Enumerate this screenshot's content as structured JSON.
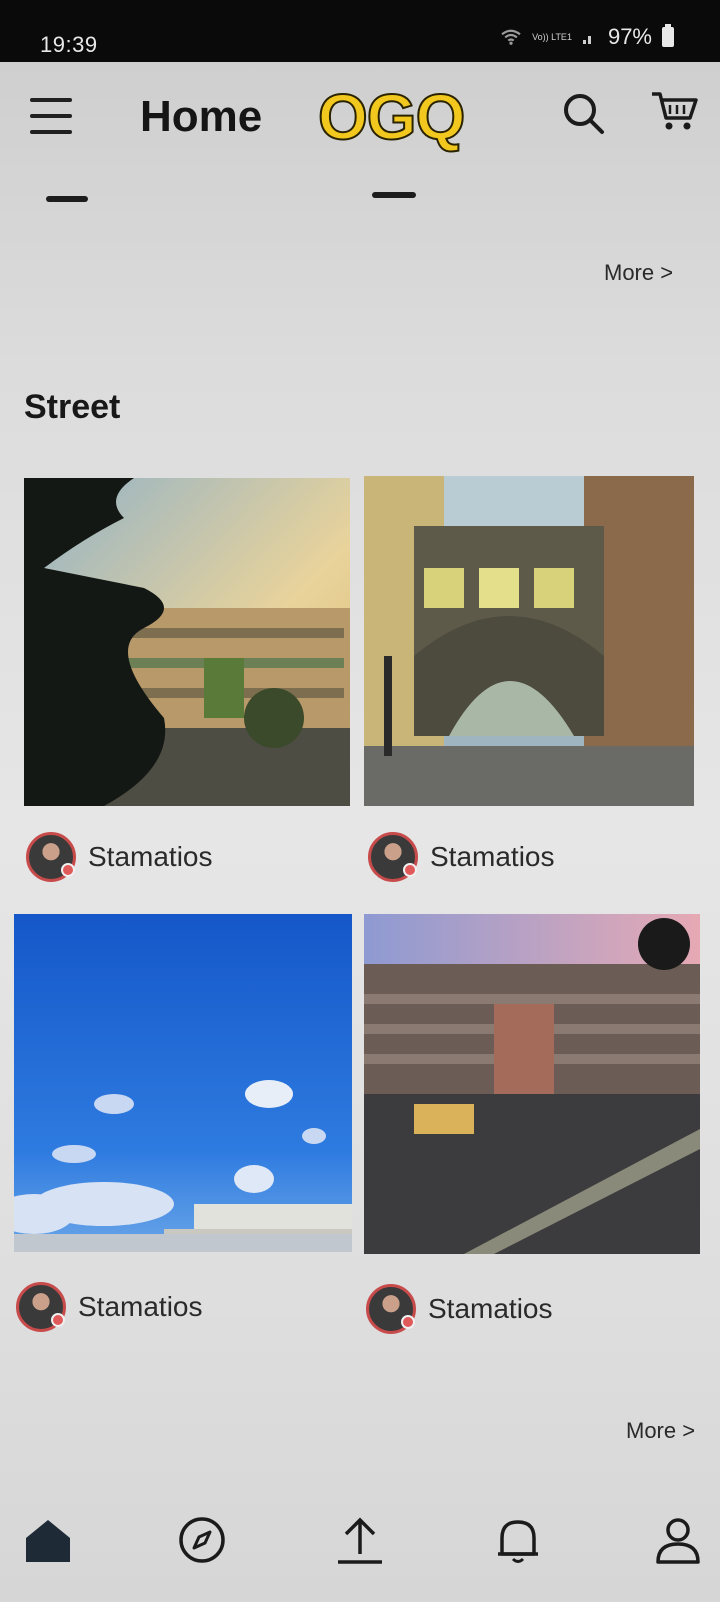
{
  "status_bar": {
    "time": "19:39",
    "network": "Vo)) LTE1",
    "battery": "97%"
  },
  "header": {
    "title": "Home",
    "logo": "OGQ"
  },
  "sections": [
    {
      "more_label": "More >"
    },
    {
      "title": "Street",
      "items": [
        {
          "author": "Stamatios"
        },
        {
          "author": "Stamatios"
        },
        {
          "author": "Stamatios"
        },
        {
          "author": "Stamatios"
        }
      ],
      "more_label": "More >"
    }
  ],
  "bottom_nav": [
    "home-icon",
    "compass-icon",
    "upload-icon",
    "bell-icon",
    "user-icon"
  ]
}
